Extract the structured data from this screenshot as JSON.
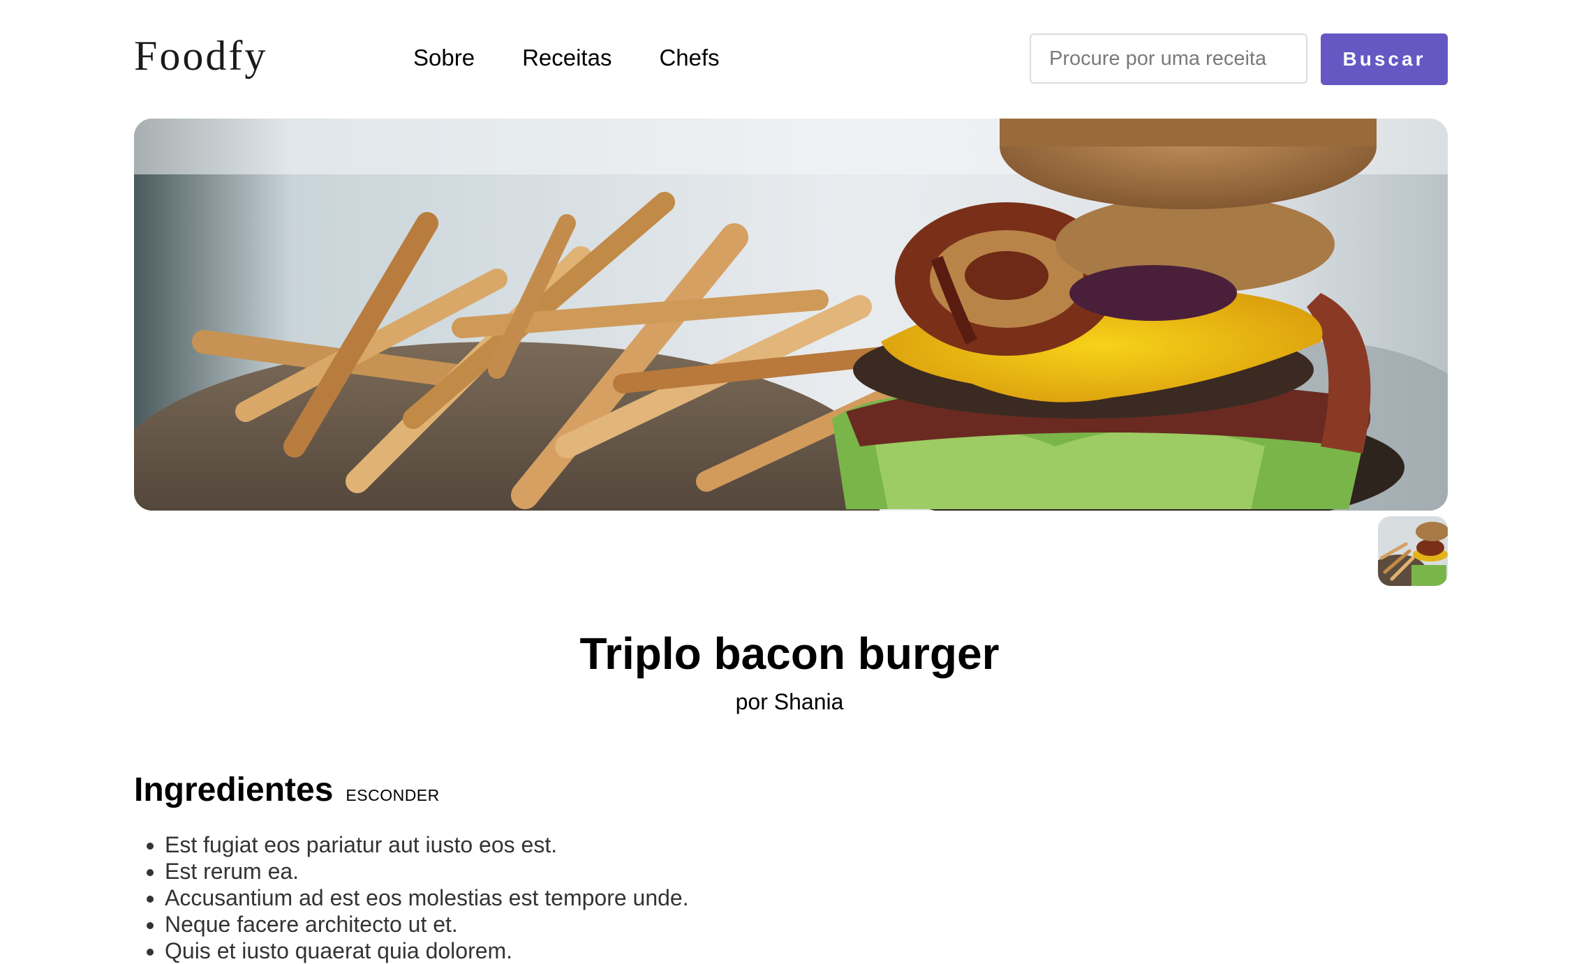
{
  "header": {
    "logo": "Foodfy",
    "nav": [
      {
        "label": "Sobre"
      },
      {
        "label": "Receitas"
      },
      {
        "label": "Chefs"
      }
    ],
    "search": {
      "placeholder": "Procure por uma receita",
      "button_label": "Buscar"
    }
  },
  "colors": {
    "accent": "#6558c3",
    "text": "#000000",
    "body_text": "#333333"
  },
  "recipe": {
    "title": "Triplo bacon burger",
    "author": "por Shania",
    "ingredients_heading": "Ingredientes",
    "ingredients_toggle": "ESCONDER",
    "ingredients": [
      "Est fugiat eos pariatur aut iusto eos est.",
      "Est rerum ea.",
      "Accusantium ad est eos molestias est tempore unde.",
      "Neque facere architecto ut et.",
      "Quis et iusto quaerat quia dolorem."
    ]
  }
}
